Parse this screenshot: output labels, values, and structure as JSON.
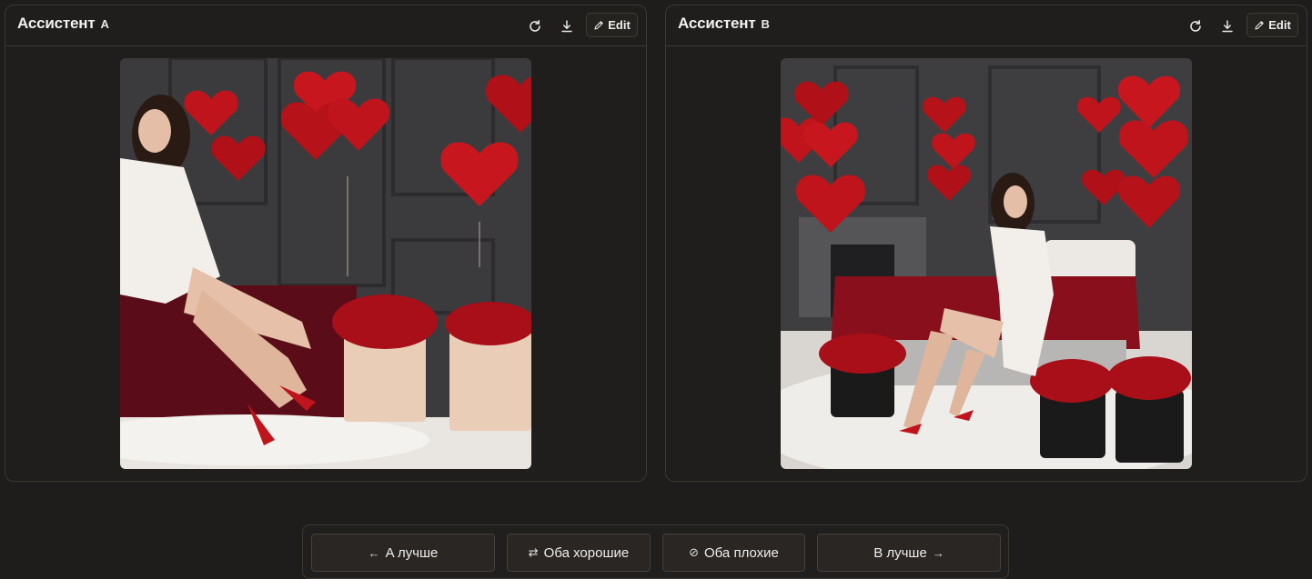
{
  "panels": {
    "a": {
      "title": "Ассистент",
      "letter": "A",
      "edit_label": "Edit"
    },
    "b": {
      "title": "Ассистент",
      "letter": "B",
      "edit_label": "Edit"
    }
  },
  "vote_bar": {
    "a_better": {
      "arrow": "←",
      "label": "A лучше"
    },
    "both_good": {
      "icon": "⇄",
      "label": "Оба хорошие"
    },
    "both_bad": {
      "icon": "⊘",
      "label": "Оба плохие"
    },
    "b_better": {
      "label": "B лучше",
      "arrow": "→"
    }
  },
  "colors": {
    "background": "#1e1d1b",
    "panel_border": "#3a3936",
    "button_bg": "#2a2624",
    "balloon_red": "#c0141c",
    "rose_red": "#b3101a"
  },
  "icons": [
    "refresh-icon",
    "download-icon",
    "pencil-icon",
    "arrow-left-icon",
    "swap-icon",
    "ban-icon",
    "arrow-right-icon"
  ]
}
